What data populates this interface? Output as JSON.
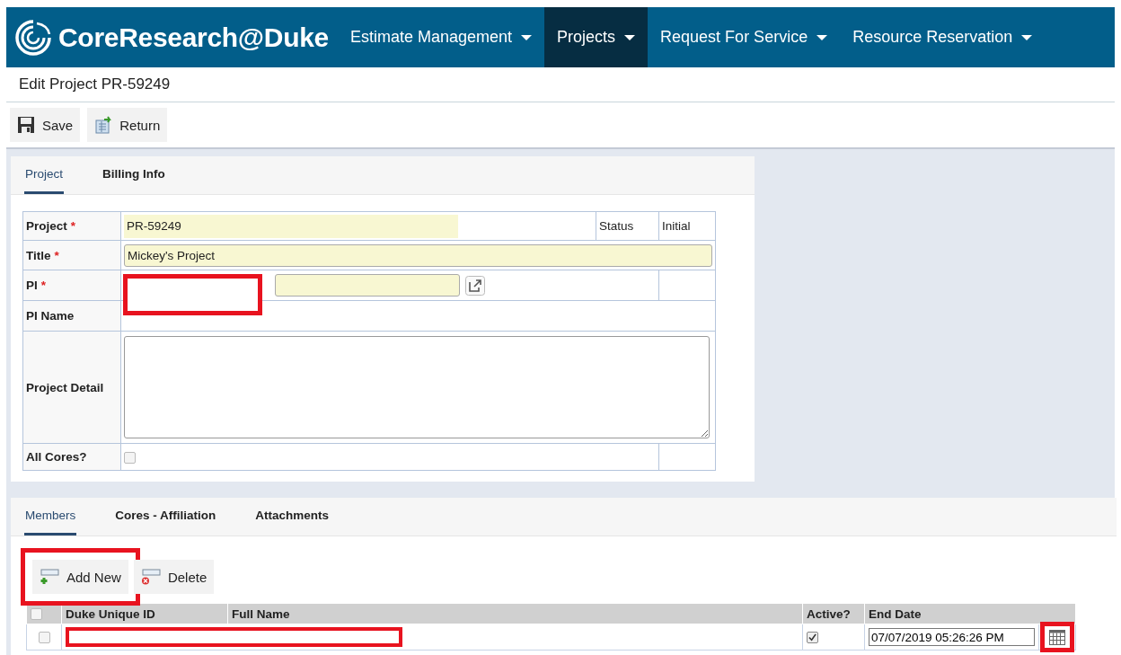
{
  "nav": {
    "logo": "CoreResearch@Duke",
    "items": [
      {
        "label": "Estimate Management",
        "selected": false
      },
      {
        "label": "Projects",
        "selected": true
      },
      {
        "label": "Request For Service",
        "selected": false
      },
      {
        "label": "Resource Reservation",
        "selected": false
      }
    ]
  },
  "page_title": "Edit Project PR-59249",
  "toolbar": [
    {
      "kind": "save",
      "label": "Save"
    },
    {
      "kind": "return",
      "label": "Return"
    }
  ],
  "form_tabs": [
    {
      "label": "Project",
      "selected": true
    },
    {
      "label": "Billing Info",
      "selected": false
    }
  ],
  "form": {
    "project": {
      "label": "Project",
      "required_mark": "*",
      "value": "PR-59249"
    },
    "status": {
      "label": "Status",
      "value": "Initial"
    },
    "title": {
      "label": "Title",
      "required_mark": "*",
      "value": "Mickey's Project"
    },
    "pi": {
      "label": "PI",
      "required_mark": "*",
      "highlighted": true
    },
    "pi_name": {
      "label": "PI Name"
    },
    "project_detail": {
      "label": "Project Detail"
    },
    "all_cores": {
      "label": "All Cores?",
      "checked": false
    }
  },
  "member_tabs": [
    {
      "label": "Members",
      "selected": true
    },
    {
      "label": "Cores - Affiliation",
      "selected": false
    },
    {
      "label": "Attachments",
      "selected": false
    }
  ],
  "member_actions": [
    {
      "kind": "add",
      "label": "Add New",
      "highlighted": true
    },
    {
      "kind": "delete",
      "label": "Delete",
      "highlighted": false
    }
  ],
  "members": {
    "all_selected": false,
    "columns": [
      "Duke Unique ID",
      "Full Name",
      "Active?",
      "End Date"
    ],
    "rows": [
      {
        "selected": false,
        "id_redacted": true,
        "active": true,
        "end_date": "07/07/2019 05:26:26 PM",
        "calendar_highlighted": true
      }
    ]
  }
}
